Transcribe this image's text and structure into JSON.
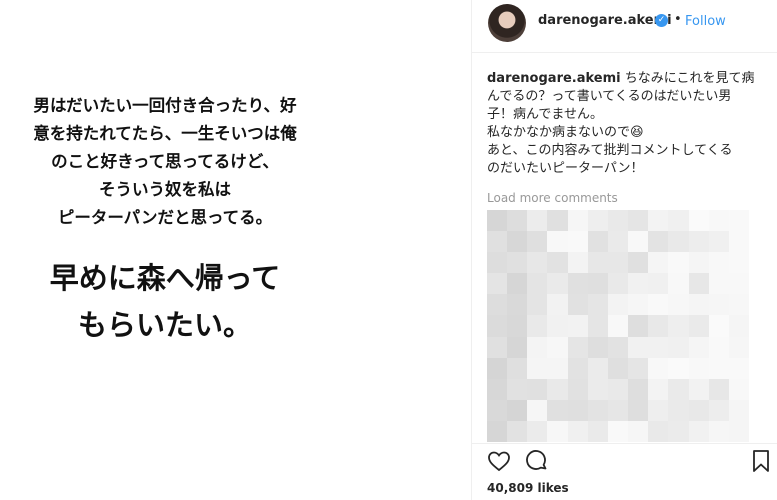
{
  "post_image": {
    "text_small_lines": [
      "男はだいたい一回付き合ったり、好",
      "意を持たれてたら、一生そいつは俺",
      "のこと好きって思ってるけど、",
      "そういう奴を私は",
      "ピーターパンだと思ってる。"
    ],
    "text_big_lines": [
      "早めに森へ帰って",
      "もらいたい。"
    ]
  },
  "header": {
    "avatar": "profile-avatar",
    "username": "darenogare.akemi",
    "verified_icon": "verified-badge-icon",
    "separator": "•",
    "follow_label": "Follow"
  },
  "caption": {
    "username": "darenogare.akemi",
    "text_lines": [
      "ちなみにこれを見て病",
      "んでるの？って書いてくるのはだいたい男",
      "子！病んでません。",
      "私なかなか病まないので😆",
      "あと、この内容みて批判コメントしてくる",
      "のだいたいピーターパン！"
    ]
  },
  "comments": {
    "load_more_label": "Load more comments",
    "content_state": "pixelated/blurred"
  },
  "actions": {
    "like_icon": "heart-icon",
    "comment_icon": "comment-bubble-icon",
    "save_icon": "bookmark-icon"
  },
  "likes_text": "40,809 likes",
  "colors": {
    "accent": "#3897f0",
    "text": "#262626",
    "muted": "#999999",
    "divider": "#efefef"
  }
}
